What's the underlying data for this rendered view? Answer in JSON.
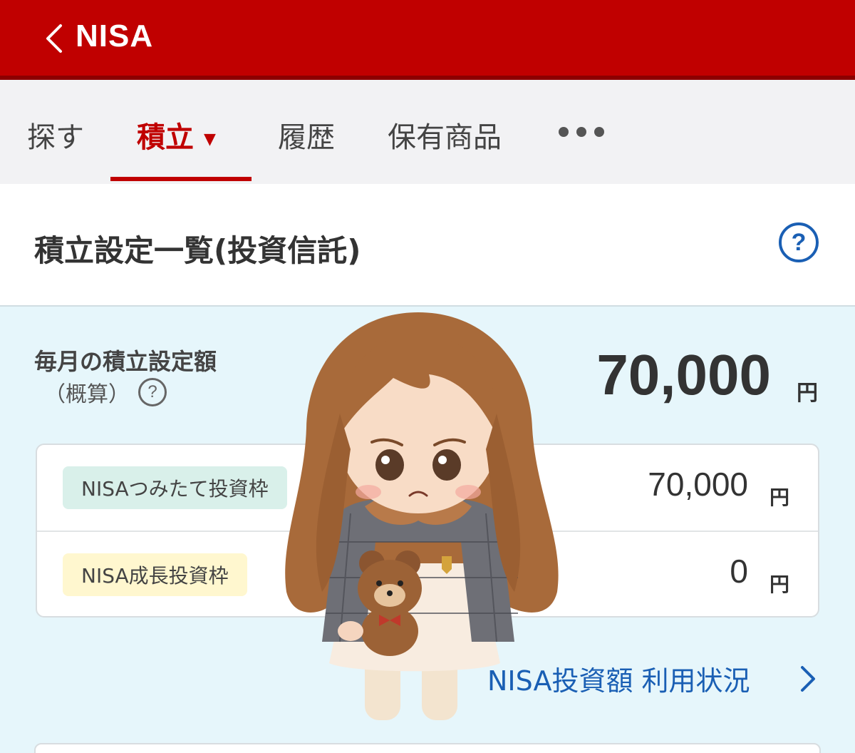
{
  "header": {
    "title": "NISA",
    "back_icon": "chevron-left-icon",
    "bg_color": "#c00000"
  },
  "tabs": [
    {
      "label": "探す"
    },
    {
      "label": "積立",
      "active": true,
      "caret": "▼"
    },
    {
      "label": "履歴"
    },
    {
      "label": "保有商品"
    }
  ],
  "more_icon": "more-dots-icon",
  "section": {
    "title": "積立設定一覧(投資信託)",
    "help": "?"
  },
  "monthly": {
    "label": "毎月の積立設定額",
    "sub_label": "（概算）",
    "help": "?",
    "amount": "70,000",
    "unit": "円"
  },
  "breakdown": [
    {
      "label": "NISAつみたて投資枠",
      "amount": "70,000",
      "unit": "円",
      "color": "#d9f0ea"
    },
    {
      "label": "NISA成長投資枠",
      "amount": "0",
      "unit": "円",
      "color": "#fff7cf"
    }
  ],
  "usage_link": {
    "label": "NISA投資額 利用状況",
    "icon": "chevron-right-icon"
  },
  "colors": {
    "accent": "#c00000",
    "link": "#1a5fb4",
    "panel_bg": "#e6f6fb"
  }
}
